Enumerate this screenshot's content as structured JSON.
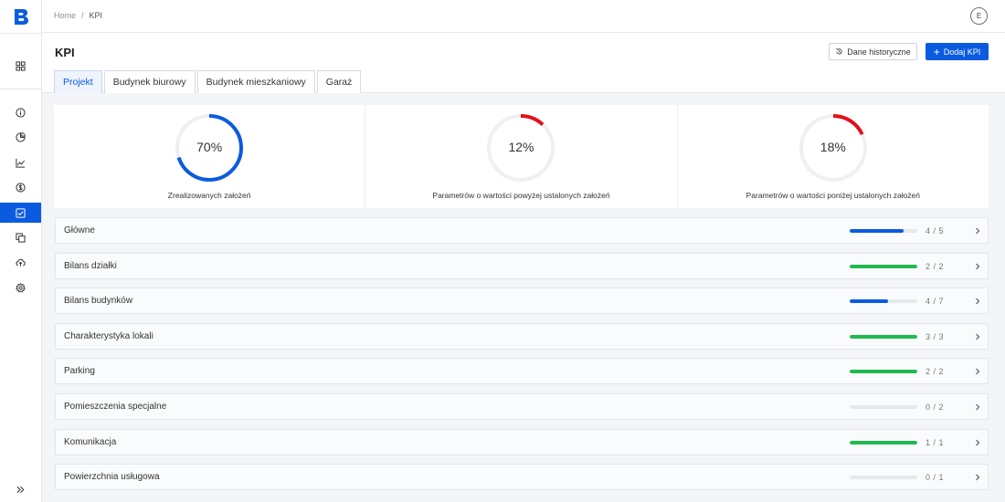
{
  "app": {
    "logo": "B"
  },
  "breadcrumb": {
    "home": "Home",
    "separator": "/",
    "current": "KPI"
  },
  "user": {
    "initial": "E"
  },
  "page": {
    "title": "KPI"
  },
  "actions": {
    "historical_label": "Dane historyczne",
    "add_label": "Dodaj KPI",
    "add_icon": "+"
  },
  "tabs": [
    {
      "label": "Projekt",
      "active": true
    },
    {
      "label": "Budynek biurowy",
      "active": false
    },
    {
      "label": "Budynek mieszkaniowy",
      "active": false
    },
    {
      "label": "Garaż",
      "active": false
    }
  ],
  "kpis": [
    {
      "value": "70%",
      "percent": 70,
      "color": "#0a5be0",
      "label": "Zrealizowanych założeń"
    },
    {
      "value": "12%",
      "percent": 12,
      "color": "#e3101a",
      "label": "Parametrów o wartości powyżej ustalonych założeń"
    },
    {
      "value": "18%",
      "percent": 18,
      "color": "#e3101a",
      "label": "Parametrów o wartości poniżej ustalonych założeń"
    }
  ],
  "categories": [
    {
      "name": "Główne",
      "done": 4,
      "total": 5,
      "count": "4 / 5",
      "color": "#0a5be0"
    },
    {
      "name": "Bilans działki",
      "done": 2,
      "total": 2,
      "count": "2 / 2",
      "color": "#1fba4f"
    },
    {
      "name": "Bilans budynków",
      "done": 4,
      "total": 7,
      "count": "4 / 7",
      "color": "#0a5be0"
    },
    {
      "name": "Charakterystyka lokali",
      "done": 3,
      "total": 3,
      "count": "3 / 3",
      "color": "#1fba4f"
    },
    {
      "name": "Parking",
      "done": 2,
      "total": 2,
      "count": "2 / 2",
      "color": "#1fba4f"
    },
    {
      "name": "Pomieszczenia specjalne",
      "done": 0,
      "total": 2,
      "count": "0 / 2",
      "color": "#e6e8ec"
    },
    {
      "name": "Komunikacja",
      "done": 1,
      "total": 1,
      "count": "1 / 1",
      "color": "#1fba4f"
    },
    {
      "name": "Powierzchnia usługowa",
      "done": 0,
      "total": 1,
      "count": "0 / 1",
      "color": "#e6e8ec"
    }
  ],
  "sidebar": {
    "items": [
      {
        "icon": "grid-icon"
      },
      {
        "icon": "info-icon"
      },
      {
        "icon": "pie-chart-icon"
      },
      {
        "icon": "line-chart-icon"
      },
      {
        "icon": "dollar-icon"
      },
      {
        "icon": "checkbox-icon",
        "active": true
      },
      {
        "icon": "copy-icon"
      },
      {
        "icon": "cloud-upload-icon"
      },
      {
        "icon": "gear-icon"
      },
      {
        "icon": "expand-icon"
      }
    ]
  }
}
